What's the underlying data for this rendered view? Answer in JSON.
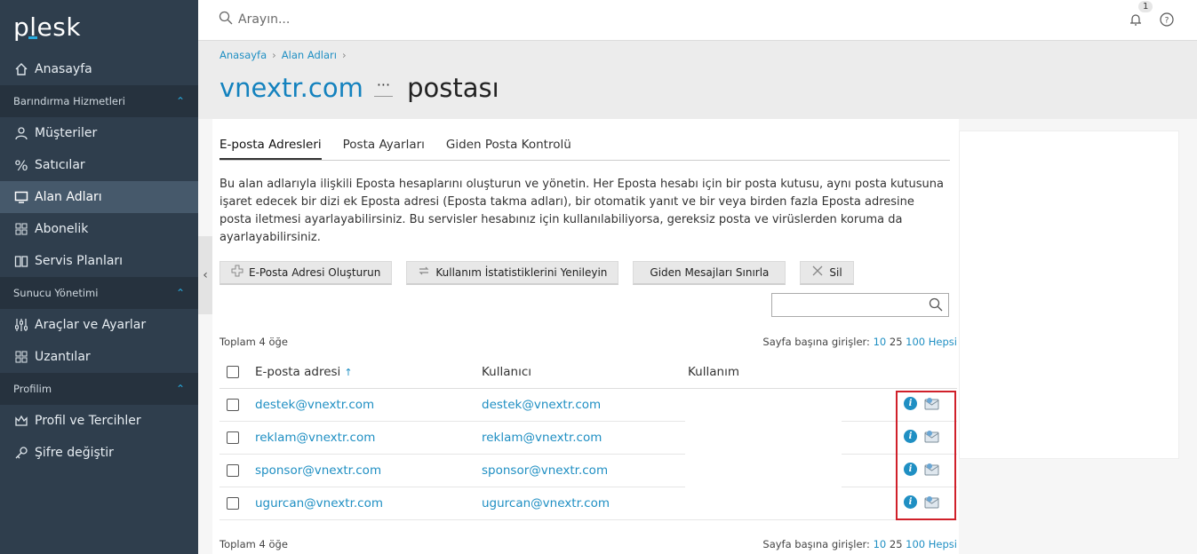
{
  "logo": "plesk",
  "search": {
    "placeholder": "Arayın..."
  },
  "notifications": {
    "count": "1"
  },
  "sidebar": {
    "home": "Anasayfa",
    "sections": [
      {
        "title": "Barındırma Hizmetleri",
        "items": [
          "Müşteriler",
          "Satıcılar",
          "Alan Adları",
          "Abonelik",
          "Servis Planları"
        ]
      },
      {
        "title": "Sunucu Yönetimi",
        "items": [
          "Araçlar ve Ayarlar",
          "Uzantılar"
        ]
      },
      {
        "title": "Profilim",
        "items": [
          "Profil ve Tercihler",
          "Şifre değiştir"
        ]
      }
    ],
    "active_item": "Alan Adları"
  },
  "breadcrumb": [
    "Anasayfa",
    "Alan Adları"
  ],
  "title": {
    "domain": "vnextr.com",
    "more": "···",
    "rest": "postası"
  },
  "tabs": [
    "E-posta Adresleri",
    "Posta Ayarları",
    "Giden Posta Kontrolü"
  ],
  "active_tab": "E-posta Adresleri",
  "description": "Bu alan adlarıyla ilişkili Eposta hesaplarını oluşturun ve yönetin. Her Eposta hesabı için bir posta kutusu, aynı posta kutusuna işaret edecek bir dizi ek Eposta adresi (Eposta takma adları), bir otomatik yanıt ve bir veya birden fazla Eposta adresine posta iletmesi ayarlayabilirsiniz. Bu servisler hesabınız için kullanılabiliyorsa, gereksiz posta ve virüslerden koruma da ayarlayabilirsiniz.",
  "toolbar": {
    "create": "E-Posta Adresi Oluşturun",
    "refresh": "Kullanım İstatistiklerini Yenileyin",
    "limit": "Giden Mesajları Sınırla",
    "delete": "Sil"
  },
  "list": {
    "total": "Toplam 4 öğe",
    "per_page_label": "Sayfa başına girişler:",
    "per_page_options": [
      "10",
      "25",
      "100",
      "Hepsi"
    ],
    "columns": {
      "email": "E-posta adresi",
      "user": "Kullanıcı",
      "usage": "Kullanım"
    },
    "sort_indicator": "↑",
    "rows": [
      {
        "email": "destek@vnextr.com",
        "user": "destek@vnextr.com"
      },
      {
        "email": "reklam@vnextr.com",
        "user": "reklam@vnextr.com"
      },
      {
        "email": "sponsor@vnextr.com",
        "user": "sponsor@vnextr.com"
      },
      {
        "email": "ugurcan@vnextr.com",
        "user": "ugurcan@vnextr.com"
      }
    ]
  },
  "colors": {
    "sidebar": "#2f3e4d",
    "accent": "#1f8fc3",
    "highlight": "#d0202a"
  }
}
